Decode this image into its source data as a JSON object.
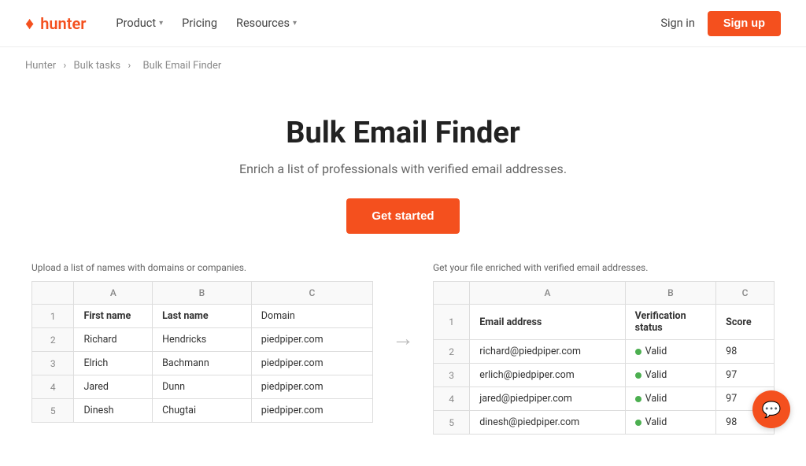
{
  "brand": {
    "icon": "♦",
    "name": "hunter"
  },
  "nav": {
    "product_label": "Product",
    "pricing_label": "Pricing",
    "resources_label": "Resources",
    "signin_label": "Sign in",
    "signup_label": "Sign up"
  },
  "breadcrumb": {
    "items": [
      "Hunter",
      "Bulk tasks",
      "Bulk Email Finder"
    ]
  },
  "hero": {
    "title": "Bulk Email Finder",
    "subtitle": "Enrich a list of professionals with verified email addresses.",
    "cta_label": "Get started"
  },
  "input_table": {
    "label": "Upload a list of names with domains or companies.",
    "col_headers": [
      "",
      "A",
      "B",
      "C"
    ],
    "rows": [
      {
        "num": "1",
        "a": "First name",
        "b": "Last name",
        "c": "Domain",
        "bold": true
      },
      {
        "num": "2",
        "a": "Richard",
        "b": "Hendricks",
        "c": "piedpiper.com",
        "bold": false
      },
      {
        "num": "3",
        "a": "Elrich",
        "b": "Bachmann",
        "c": "piedpiper.com",
        "bold": false
      },
      {
        "num": "4",
        "a": "Jared",
        "b": "Dunn",
        "c": "piedpiper.com",
        "bold": false
      },
      {
        "num": "5",
        "a": "Dinesh",
        "b": "Chugtai",
        "c": "piedpiper.com",
        "bold": false
      }
    ]
  },
  "output_table": {
    "label": "Get your file enriched with verified email addresses.",
    "col_headers": [
      "",
      "A",
      "B",
      "C"
    ],
    "rows": [
      {
        "num": "1",
        "a": "Email address",
        "b": "Verification status",
        "c": "Score",
        "bold": true
      },
      {
        "num": "2",
        "a": "richard@piedpiper.com",
        "b": "Valid",
        "c": "98",
        "bold": false
      },
      {
        "num": "3",
        "a": "erlich@piedpiper.com",
        "b": "Valid",
        "c": "97",
        "bold": false
      },
      {
        "num": "4",
        "a": "jared@piedpiper.com",
        "b": "Valid",
        "c": "97",
        "bold": false
      },
      {
        "num": "5",
        "a": "dinesh@piedpiper.com",
        "b": "Valid",
        "c": "98",
        "bold": false
      }
    ]
  }
}
